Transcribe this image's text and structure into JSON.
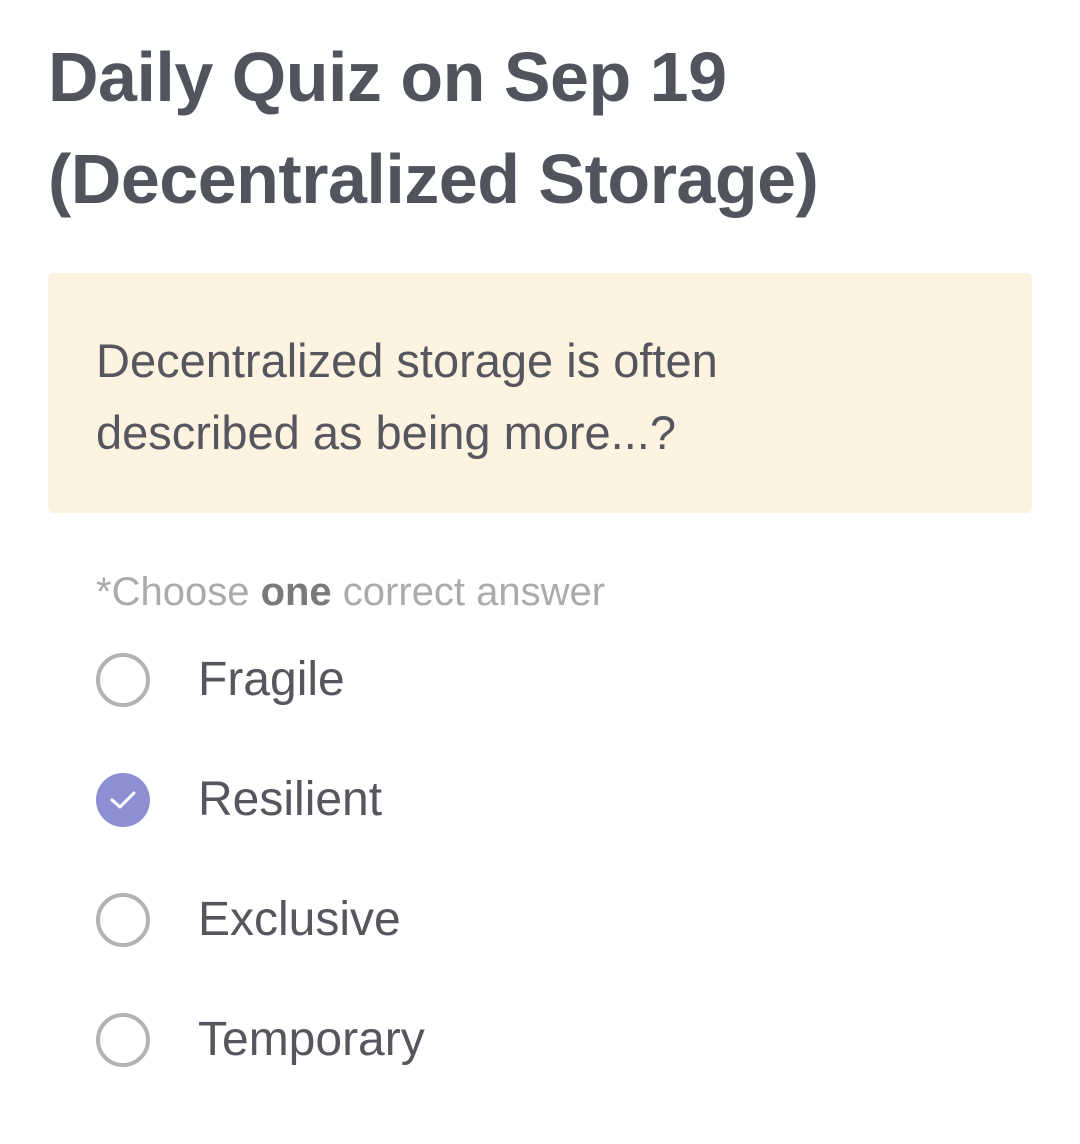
{
  "quiz": {
    "title": "Daily Quiz on Sep 19 (Decentralized Storage)",
    "question": "Decentralized storage is often described as being more...?",
    "instruction": {
      "prefix": "*Choose ",
      "emphasis": "one",
      "suffix": " correct answer"
    },
    "options": [
      {
        "label": "Fragile",
        "selected": false
      },
      {
        "label": "Resilient",
        "selected": true
      },
      {
        "label": "Exclusive",
        "selected": false
      },
      {
        "label": "Temporary",
        "selected": false
      }
    ]
  },
  "colors": {
    "title_text": "#51535d",
    "question_background": "#fef3e0",
    "radio_selected": "#8d8fd3",
    "radio_unselected_border": "#b3b3b3",
    "instruction_text": "#ababab"
  },
  "icons": {
    "selected_radio": "checkmark-icon"
  }
}
